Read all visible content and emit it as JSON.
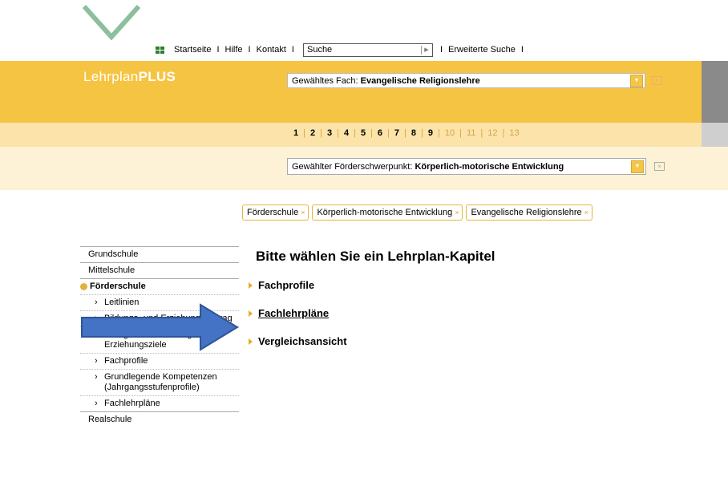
{
  "topnav": {
    "items": [
      "Startseite",
      "Hilfe",
      "Kontakt"
    ],
    "search_value": "Suche",
    "extended_search": "Erweiterte Suche",
    "separator": "I"
  },
  "header": {
    "brand_light": "Lehrplan",
    "brand_bold": "PLUS",
    "fach_label": "Gewähltes Fach: ",
    "fach_value": "Evangelische Religionslehre"
  },
  "grades": {
    "active": [
      "1",
      "2",
      "3",
      "4",
      "5",
      "6",
      "7",
      "8",
      "9"
    ],
    "inactive": [
      "10",
      "11",
      "12",
      "13"
    ],
    "separator": "|"
  },
  "foerder": {
    "label": "Gewählter Förderschwerpunkt: ",
    "value": "Körperlich-motorische Entwicklung"
  },
  "chips": [
    "Förderschule",
    "Körperlich-motorische Entwicklung",
    "Evangelische Religionslehre"
  ],
  "sidebar": {
    "items": [
      {
        "label": "Grundschule"
      },
      {
        "label": "Mittelschule"
      },
      {
        "label": "Förderschule",
        "active": true
      }
    ],
    "subitems": [
      "Leitlinien",
      "Bildungs- und Erziehungsauftrag",
      "Übergreifende Bildungs- und Erziehungsziele",
      "Fachprofile",
      "Grundlegende Kompetenzen (Jahrgangsstufenprofile)",
      "Fachlehrpläne"
    ],
    "after": "Realschule"
  },
  "main": {
    "heading": "Bitte wählen Sie ein Lehrplan-Kapitel",
    "chapters": [
      "Fachprofile",
      "Fachlehrpläne",
      "Vergleichsansicht"
    ]
  },
  "colors": {
    "header_yellow": "#f6c443",
    "grade_bar": "#fbe3a9",
    "foerder_bar": "#fdf2d5",
    "arrow_fill": "#4472c4",
    "arrow_stroke": "#2f5597",
    "logo_green": "#8cbf9c"
  },
  "icons": {
    "logo": "chevron-logo-icon",
    "grid": "grid-icon",
    "go": "search-go-icon",
    "dropdown": "dropdown-arrow-icon",
    "close": "close-icon",
    "bullet": "triangle-bullet-icon",
    "overlay": "arrow-overlay-icon"
  }
}
